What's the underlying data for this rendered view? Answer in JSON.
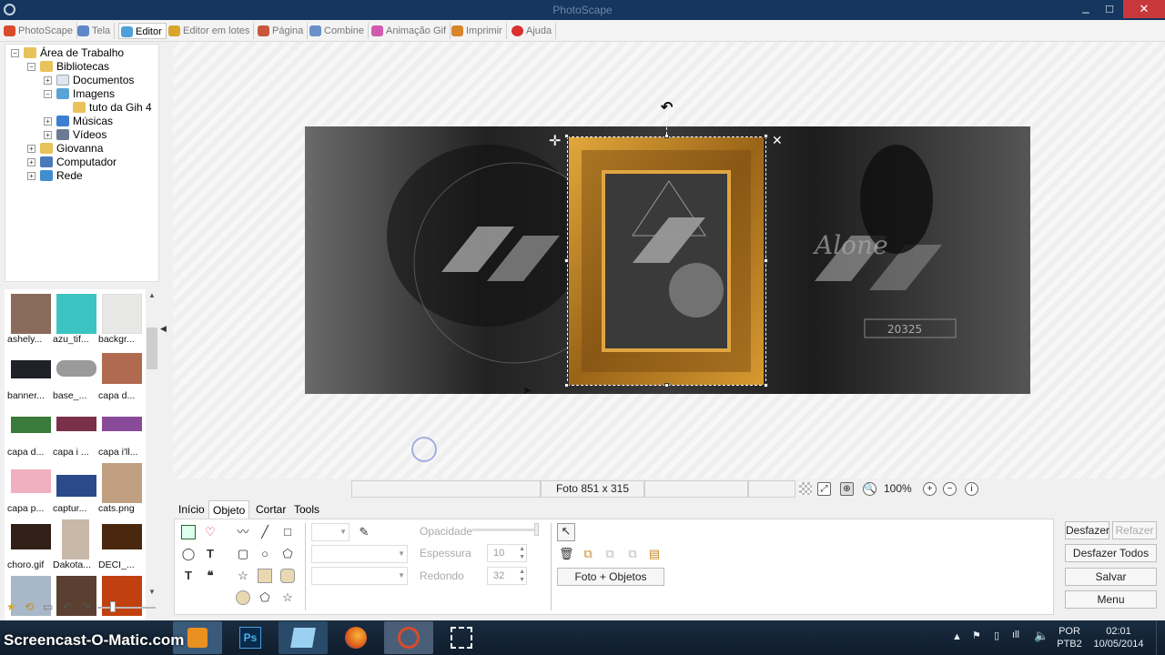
{
  "window": {
    "title": "PhotoScape"
  },
  "menu": [
    {
      "label": "PhotoScape",
      "color": "#d94b2b"
    },
    {
      "label": "Tela",
      "color": "#5d87c9"
    },
    {
      "label": "Editor",
      "color": "#4fa0d8"
    },
    {
      "label": "Editor em lotes",
      "color": "#d9a62b"
    },
    {
      "label": "Página",
      "color": "#c9573b"
    },
    {
      "label": "Combine",
      "color": "#6b8fc9"
    },
    {
      "label": "Animação Gif",
      "color": "#d05bb0"
    },
    {
      "label": "Imprimir",
      "color": "#d9862b"
    },
    {
      "label": "Ajuda",
      "color": "#d93030"
    }
  ],
  "tree": [
    {
      "label": "Área de Trabalho",
      "expander": "−",
      "color": "#e8c25a"
    },
    {
      "label": "Bibliotecas",
      "expander": "−",
      "color": "#e8c25a"
    },
    {
      "label": "Documentos",
      "expander": "+",
      "color": "#dfe6ef"
    },
    {
      "label": "Imagens",
      "expander": "−",
      "color": "#5aa3d6"
    },
    {
      "label": "tuto da Gih 4",
      "expander": "",
      "color": "#e8c25a"
    },
    {
      "label": "Músicas",
      "expander": "+",
      "color": "#3d7fd0"
    },
    {
      "label": "Vídeos",
      "expander": "+",
      "color": "#6c7b94"
    },
    {
      "label": "Giovanna",
      "expander": "+",
      "color": "#e8c25a"
    },
    {
      "label": "Computador",
      "expander": "+",
      "color": "#4a78b8"
    },
    {
      "label": "Rede",
      "expander": "+",
      "color": "#3f8fd0"
    }
  ],
  "thumbnails": [
    {
      "name": "ashely...",
      "color": "#8a6a5a"
    },
    {
      "name": "azu_tif...",
      "color": "#3cc4c4"
    },
    {
      "name": "backgr...",
      "color": "#e8e8e6"
    },
    {
      "name": "banner...",
      "color": "#202028"
    },
    {
      "name": "base_...",
      "color": "#9a9a9a"
    },
    {
      "name": "capa d...",
      "color": "#b06a50"
    },
    {
      "name": "capa d...",
      "color": "#3a7a3a"
    },
    {
      "name": "capa i ...",
      "color": "#7a3048"
    },
    {
      "name": "capa i'll...",
      "color": "#8a4a9a"
    },
    {
      "name": "capa p...",
      "color": "#f0b0c0"
    },
    {
      "name": "captur...",
      "color": "#2a4a8a"
    },
    {
      "name": "cats.png",
      "color": "#c0a080"
    },
    {
      "name": "choro.gif",
      "color": "#302018"
    },
    {
      "name": "Dakota...",
      "color": "#c8b8a8"
    },
    {
      "name": "DECI_...",
      "color": "#4a2810"
    },
    {
      "name": "",
      "color": "#a8b8c8"
    },
    {
      "name": "",
      "color": "#5a4030"
    },
    {
      "name": "",
      "color": "#c04010"
    }
  ],
  "statusbar": {
    "size": "Foto 851 x 315",
    "zoom": "100%"
  },
  "tabs": [
    "Início",
    "Objeto",
    "Cortar",
    "Tools"
  ],
  "panel": {
    "opacity_label": "Opacidade",
    "thickness_label": "Espessura",
    "thickness_value": "10",
    "round_label": "Redondo",
    "round_value": "32",
    "photo_objects_button": "Foto + Objetos"
  },
  "right_buttons": {
    "undo": "Desfazer",
    "redo": "Refazer",
    "undo_all": "Desfazer Todos",
    "save": "Salvar",
    "menu": "Menu"
  },
  "taskbar": {
    "watermark": "Screencast-O-Matic.com",
    "lang1": "POR",
    "lang2": "PTB2",
    "time": "02:01",
    "date": "10/05/2014"
  }
}
